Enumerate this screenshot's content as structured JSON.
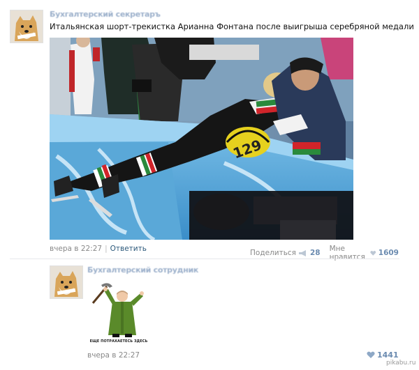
{
  "post": {
    "author": "Бухгалтерский секретаръ",
    "text": "Итальянская шорт-трекистка Арианна Фонтана после выигрыша серебряной медали",
    "helmet_number": "129",
    "timestamp": "вчера в 22:27",
    "reply_label": "Ответить",
    "share_label": "Поделиться",
    "share_count": "28",
    "like_label": "Мне нравится",
    "like_count": "1609"
  },
  "comment": {
    "author": "Бухгалтерский сотрудник",
    "sticker_caption": "ЕЩЕ ПОТРАХАЕТЕСЬ ЗДЕСЬ",
    "timestamp": "вчера в 22:27",
    "like_count": "1441"
  },
  "watermark": "pikabu.ru",
  "colors": {
    "link": "#2b587a",
    "meta": "#888888",
    "accent_count": "#6b8bb0"
  },
  "icons": [
    "doge-avatar",
    "megaphone-icon",
    "heart-icon"
  ]
}
